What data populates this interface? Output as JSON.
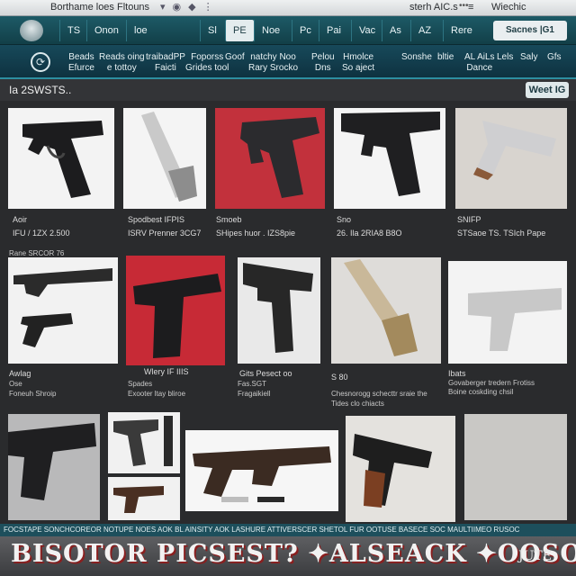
{
  "titlebar": {
    "title": "Borthame loes Fltouns",
    "mid_icons": [
      "▾",
      "◉",
      "◆",
      "⋮"
    ],
    "right_text": "sterh AIC.s",
    "dots": "•••",
    "menu_icon": "≡",
    "brand": "Wiechic"
  },
  "nav1": {
    "tabs": [
      "TS",
      "Onon",
      "loe",
      "Sl",
      "PE",
      "Noe",
      "Pc",
      "Pai",
      "Vac",
      "As",
      "AZ",
      "Rere"
    ],
    "search_button": "Sacnes |G1",
    "gear_icon": "⚙"
  },
  "nav2": {
    "items": [
      {
        "l1": "Beads",
        "l2": "Efurce"
      },
      {
        "l1": "Reads oing",
        "l2": "e tottoy"
      },
      {
        "l1": "traibadPP",
        "l2": "Faicti"
      },
      {
        "l1": "Foporss",
        "l2": "Grides tool"
      },
      {
        "l1": "Goof",
        "l2": ""
      },
      {
        "l1": "natchy Noo",
        "l2": "Rary Srocko"
      },
      {
        "l1": "Pelou",
        "l2": "Dns"
      },
      {
        "l1": "Hmolce",
        "l2": "So aject"
      },
      {
        "l1": "Sonshe",
        "l2": ""
      },
      {
        "l1": "bltie",
        "l2": ""
      },
      {
        "l1": "AL AiLs",
        "l2": "Dance"
      },
      {
        "l1": "Lels",
        "l2": ""
      },
      {
        "l1": "Saly",
        "l2": ""
      },
      {
        "l1": "Gfs",
        "l2": ""
      }
    ]
  },
  "section": {
    "count_label": "Ia 2SWSTS..",
    "button": "Weet IG"
  },
  "row1": [
    {
      "name": "Aoir",
      "price": "IFU / 1ZX 2.500"
    },
    {
      "name": "Spodbest IFPIS",
      "price": "ISRV Prenner 3CG7"
    },
    {
      "name": "Smoeb",
      "price": "SHipes huor . IZS8pie"
    },
    {
      "name": "Sno",
      "price": "26. Ila 2RIA8 B8O"
    },
    {
      "name": "SNIFP",
      "price": "STSaoe TS. TSIch    Pape"
    }
  ],
  "row1_note": "Rane  SRCOR 76",
  "row2": [
    {
      "name": "Awlag",
      "sub": "Ose",
      "desc": "Foneuh Shroip"
    },
    {
      "name": "Wlery IF IIIS",
      "sub": "Spades",
      "desc": "Exooter ltay bliroe"
    },
    {
      "name": "Gits   Pesect oo",
      "sub": "Fas.SGT",
      "desc": "Fragaikiell"
    },
    {
      "name": "S 80",
      "sub": "",
      "desc": "Chesnorogg schecttr sraie the Tides clo chiacts"
    },
    {
      "name": "Ibats",
      "sub": "Govaberger tredern Frotiss",
      "desc": "Boine coskding chsil"
    }
  ],
  "ticker": "FOCSTAPE SONCHCOREOR NOTUPE NOES   AOK BL AINSITY   AOK LASHURE ATTIVERSCER SHETOL FUR OOTUSE   BASECE SOC MAULTIIMEO RUSOC",
  "banner": {
    "headline": "BISOTOR PICSEST? ✦ALSEACK ✦OOSOP",
    "tag": "JUTE"
  }
}
